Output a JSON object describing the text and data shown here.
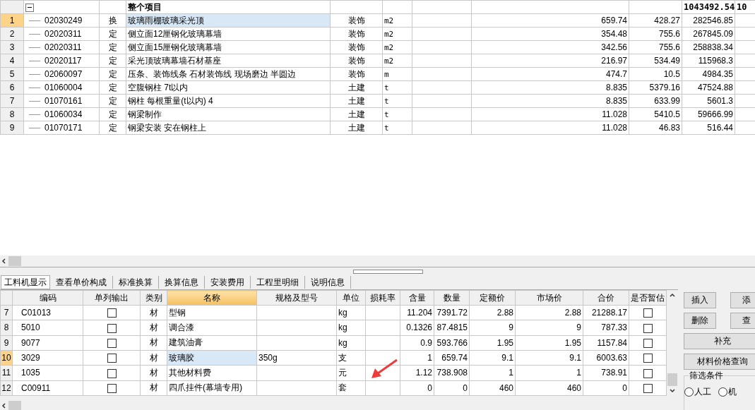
{
  "top_grid": {
    "header": {
      "expanded": true,
      "name": "整个项目",
      "total": "1043492.54",
      "column_10": "10"
    },
    "rows": [
      {
        "num": "1",
        "code": "02030249",
        "type": "换",
        "name": "玻璃雨棚玻璃采光顶",
        "category": "装饰",
        "unit": "m2",
        "quantity": "659.74",
        "unit_price": "428.27",
        "total": "282546.85",
        "selected": true
      },
      {
        "num": "2",
        "code": "02020311",
        "type": "定",
        "name": "侧立面12厘钢化玻璃幕墙",
        "category": "装饰",
        "unit": "m2",
        "quantity": "354.48",
        "unit_price": "755.6",
        "total": "267845.09",
        "selected": false
      },
      {
        "num": "3",
        "code": "02020311",
        "type": "定",
        "name": "侧立面15厘钢化玻璃幕墙",
        "category": "装饰",
        "unit": "m2",
        "quantity": "342.56",
        "unit_price": "755.6",
        "total": "258838.34",
        "selected": false
      },
      {
        "num": "4",
        "code": "02020117",
        "type": "定",
        "name": "采光顶玻璃幕墙石材基座",
        "category": "装饰",
        "unit": "m2",
        "quantity": "216.97",
        "unit_price": "534.49",
        "total": "115968.3",
        "selected": false
      },
      {
        "num": "5",
        "code": "02060097",
        "type": "定",
        "name": "压条、装饰线条 石材装饰线 现场磨边 半圆边",
        "category": "装饰",
        "unit": "m",
        "quantity": "474.7",
        "unit_price": "10.5",
        "total": "4984.35",
        "selected": false
      },
      {
        "num": "6",
        "code": "01060004",
        "type": "定",
        "name": "空腹钢柱 7t以内",
        "category": "土建",
        "unit": "t",
        "quantity": "8.835",
        "unit_price": "5379.16",
        "total": "47524.88",
        "selected": false
      },
      {
        "num": "7",
        "code": "01070161",
        "type": "定",
        "name": "钢柱 每根重量(t以内) 4",
        "category": "土建",
        "unit": "t",
        "quantity": "8.835",
        "unit_price": "633.99",
        "total": "5601.3",
        "selected": false
      },
      {
        "num": "8",
        "code": "01060034",
        "type": "定",
        "name": "钢梁制作",
        "category": "土建",
        "unit": "t",
        "quantity": "11.028",
        "unit_price": "5410.5",
        "total": "59666.99",
        "selected": false
      },
      {
        "num": "9",
        "code": "01070171",
        "type": "定",
        "name": "钢梁安装 安在钢柱上",
        "category": "土建",
        "unit": "t",
        "quantity": "11.028",
        "unit_price": "46.83",
        "total": "516.44",
        "selected": false
      }
    ]
  },
  "tabs": [
    {
      "label": "工料机显示",
      "selected": true
    },
    {
      "label": "查看单价构成",
      "selected": false
    },
    {
      "label": "标准换算",
      "selected": false
    },
    {
      "label": "换算信息",
      "selected": false
    },
    {
      "label": "安装费用",
      "selected": false
    },
    {
      "label": "工程里明细",
      "selected": false
    },
    {
      "label": "说明信息",
      "selected": false
    }
  ],
  "materials": {
    "columns": [
      {
        "label": "编码",
        "sorted": false
      },
      {
        "label": "单列输出",
        "sorted": false
      },
      {
        "label": "类别",
        "sorted": false
      },
      {
        "label": "名称",
        "sorted": true
      },
      {
        "label": "规格及型号",
        "sorted": false
      },
      {
        "label": "单位",
        "sorted": false
      },
      {
        "label": "损耗率",
        "sorted": false
      },
      {
        "label": "含量",
        "sorted": false
      },
      {
        "label": "数量",
        "sorted": false
      },
      {
        "label": "定额价",
        "sorted": false
      },
      {
        "label": "市场价",
        "sorted": false
      },
      {
        "label": "合价",
        "sorted": false
      },
      {
        "label": "是否暂估",
        "sorted": false
      }
    ],
    "rows": [
      {
        "num": "7",
        "code": "C01013",
        "single_output": false,
        "kind": "材",
        "name": "型钢",
        "unit": "kg",
        "content": "11.204",
        "quantity": "7391.72",
        "base_price": "2.88",
        "market_price": "2.88",
        "total": "21288.17",
        "estimated": false,
        "selected": false
      },
      {
        "num": "8",
        "code": "5010",
        "single_output": false,
        "kind": "材",
        "name": "调合漆",
        "unit": "kg",
        "content": "0.1326",
        "quantity": "87.4815",
        "base_price": "9",
        "market_price": "9",
        "total": "787.33",
        "estimated": false,
        "selected": false
      },
      {
        "num": "9",
        "code": "9077",
        "single_output": false,
        "kind": "材",
        "name": "建筑油膏",
        "unit": "kg",
        "content": "0.9",
        "quantity": "593.766",
        "base_price": "1.95",
        "market_price": "1.95",
        "total": "1157.84",
        "estimated": false,
        "selected": false
      },
      {
        "num": "10",
        "code": "3029",
        "single_output": false,
        "kind": "材",
        "name": "玻璃胶",
        "spec": "350g",
        "unit": "支",
        "content": "1",
        "quantity": "659.74",
        "base_price": "9.1",
        "market_price": "9.1",
        "total": "6003.63",
        "estimated": false,
        "selected": true
      },
      {
        "num": "11",
        "code": "1035",
        "single_output": false,
        "kind": "材",
        "name": "其他材料费",
        "unit": "元",
        "content": "1.12",
        "quantity": "738.908",
        "base_price": "1",
        "market_price": "1",
        "total": "738.91",
        "estimated": false,
        "selected": false
      },
      {
        "num": "12",
        "code": "C00911",
        "single_output": false,
        "kind": "材",
        "name": "四爪挂件(幕墙专用)",
        "unit": "套",
        "content": "0",
        "quantity": "0",
        "base_price": "460",
        "market_price": "460",
        "total": "0",
        "estimated": false,
        "selected": false
      }
    ]
  },
  "side_buttons": [
    {
      "label": "插入",
      "kind": "half"
    },
    {
      "label": "添",
      "kind": "half"
    },
    {
      "label": "删除",
      "kind": "half"
    },
    {
      "label": "查",
      "kind": "half"
    },
    {
      "label": "补充",
      "kind": "full"
    },
    {
      "label": "材料价格查询",
      "kind": "full"
    }
  ],
  "filter": {
    "title": "筛选条件",
    "options": [
      {
        "label": "人工",
        "selected": false
      },
      {
        "label": "机",
        "selected": false
      }
    ]
  }
}
